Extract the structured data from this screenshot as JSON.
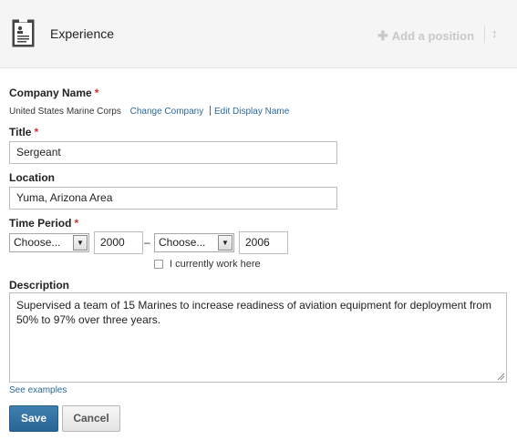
{
  "header": {
    "title": "Experience",
    "add_position_label": "Add a position",
    "icons": {
      "section": "document-icon",
      "add": "plus-icon",
      "reorder": "reorder-arrows-icon"
    }
  },
  "form": {
    "company": {
      "label": "Company Name",
      "required_marker": "*",
      "value": "United States Marine Corps",
      "change_link": "Change Company",
      "edit_display_link": "Edit Display Name"
    },
    "title": {
      "label": "Title",
      "required_marker": "*",
      "value": "Sergeant"
    },
    "location": {
      "label": "Location",
      "value": "Yuma, Arizona Area"
    },
    "time_period": {
      "label": "Time Period",
      "required_marker": "*",
      "start_month": "Choose...",
      "start_year": "2000",
      "separator": "–",
      "end_month": "Choose...",
      "end_year": "2006",
      "current_checkbox_label": "I currently work here",
      "current_checked": false
    },
    "description": {
      "label": "Description",
      "value": "Supervised a team of  15 Marines to increase readiness of aviation equipment for deployment from 50% to 97% over three years.",
      "examples_link": "See examples"
    },
    "buttons": {
      "save": "Save",
      "cancel": "Cancel"
    }
  },
  "colors": {
    "link": "#2b6a9b",
    "required": "#cc3333",
    "primary_button": "#3070a3",
    "header_bg": "#f5f5f5"
  }
}
